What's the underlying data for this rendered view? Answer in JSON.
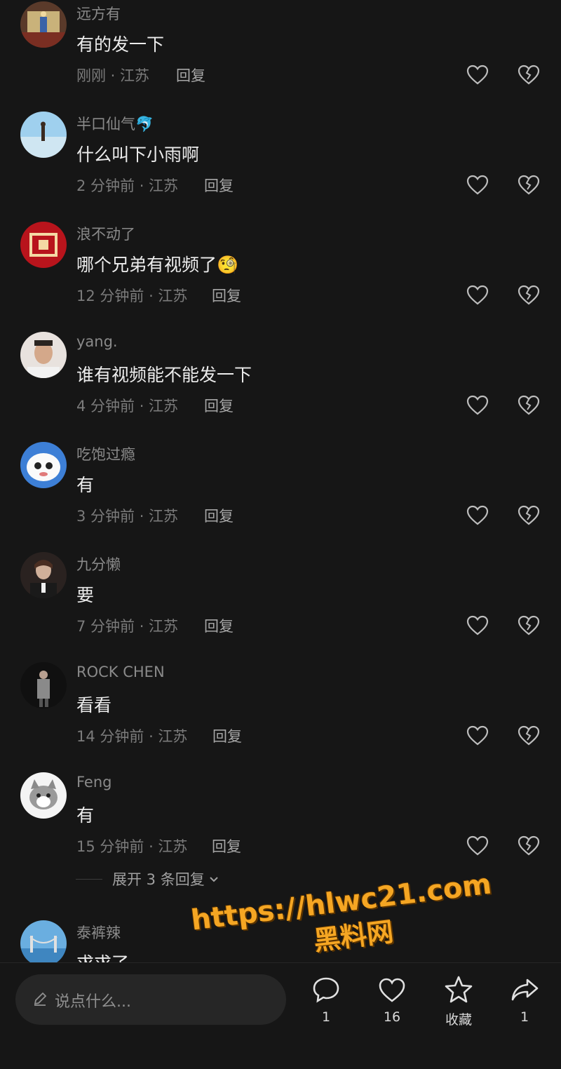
{
  "comments": [
    {
      "username": "远方有",
      "text": "有的发一下",
      "meta": "刚刚 · 江苏",
      "reply": "回复"
    },
    {
      "username": "半口仙气🐬",
      "text": "什么叫下小雨啊",
      "meta": "2 分钟前 · 江苏",
      "reply": "回复"
    },
    {
      "username": "浪不动了",
      "text": "哪个兄弟有视频了🧐",
      "meta": "12 分钟前 · 江苏",
      "reply": "回复"
    },
    {
      "username": "yang.",
      "text": "谁有视频能不能发一下",
      "meta": "4 分钟前 · 江苏",
      "reply": "回复"
    },
    {
      "username": "吃饱过瘾",
      "text": "有",
      "meta": "3 分钟前 · 江苏",
      "reply": "回复"
    },
    {
      "username": "九分懒",
      "text": "要",
      "meta": "7 分钟前 · 江苏",
      "reply": "回复"
    },
    {
      "username": "ROCK CHEN",
      "text": "看看",
      "meta": "14 分钟前 · 江苏",
      "reply": "回复"
    },
    {
      "username": "Feng",
      "text": "有",
      "meta": "15 分钟前 · 江苏",
      "reply": "回复"
    },
    {
      "username": "泰裤辣",
      "text": "求求了",
      "meta": "",
      "reply": ""
    }
  ],
  "expand_replies": "展开 3 条回复",
  "bottom_bar": {
    "input_placeholder": "说点什么...",
    "comment_count": "1",
    "like_count": "16",
    "favorite_label": "收藏",
    "share_count": "1"
  },
  "watermark": {
    "url": "https://hlwc21.com",
    "site": "黑料网"
  },
  "colors": {
    "background": "#161616",
    "username": "#8a8a8a",
    "text": "#ececec",
    "meta": "#7b7b7b",
    "watermark": "#f5a623"
  }
}
